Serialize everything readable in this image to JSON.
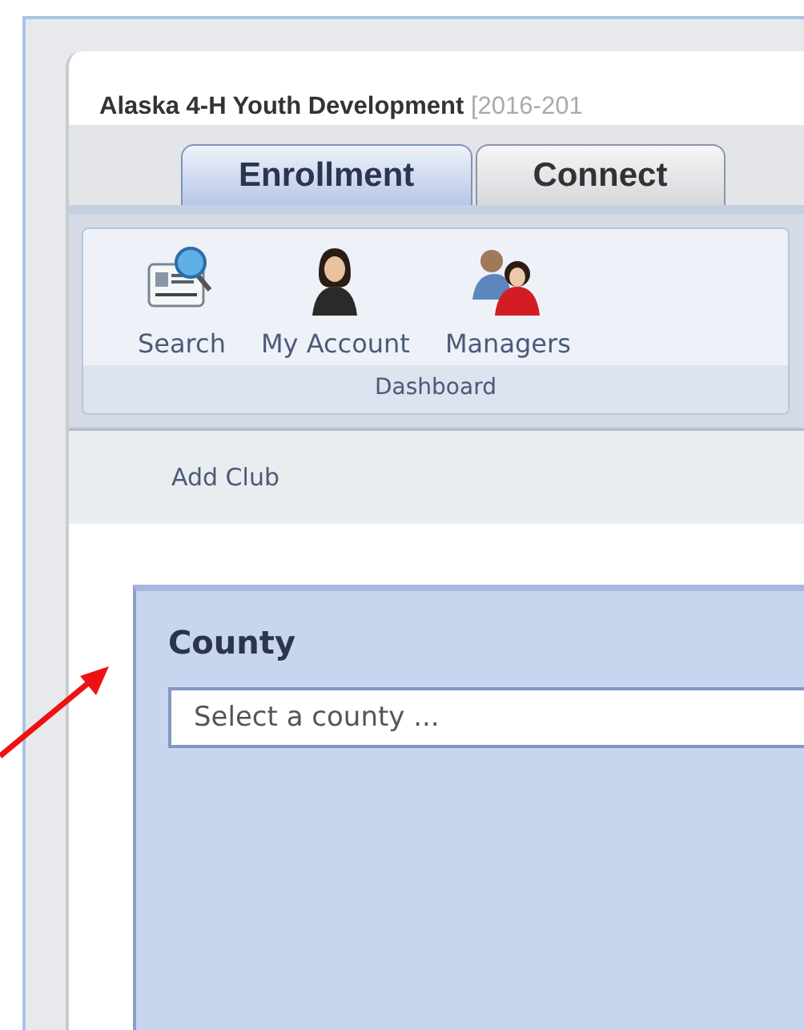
{
  "header": {
    "title": "Alaska 4-H Youth Development",
    "years": "[2016-201"
  },
  "tabs": [
    {
      "label": "Enrollment",
      "selected": true
    },
    {
      "label": "Connect",
      "selected": false
    }
  ],
  "ribbon": {
    "group": "Dashboard",
    "items": [
      {
        "label": "Search",
        "kind": "search"
      },
      {
        "label": "My Account",
        "kind": "account"
      },
      {
        "label": "Managers",
        "kind": "managers"
      }
    ]
  },
  "subnav": {
    "link": "Add Club"
  },
  "county_panel": {
    "heading": "County",
    "placeholder": "Select a county ..."
  }
}
